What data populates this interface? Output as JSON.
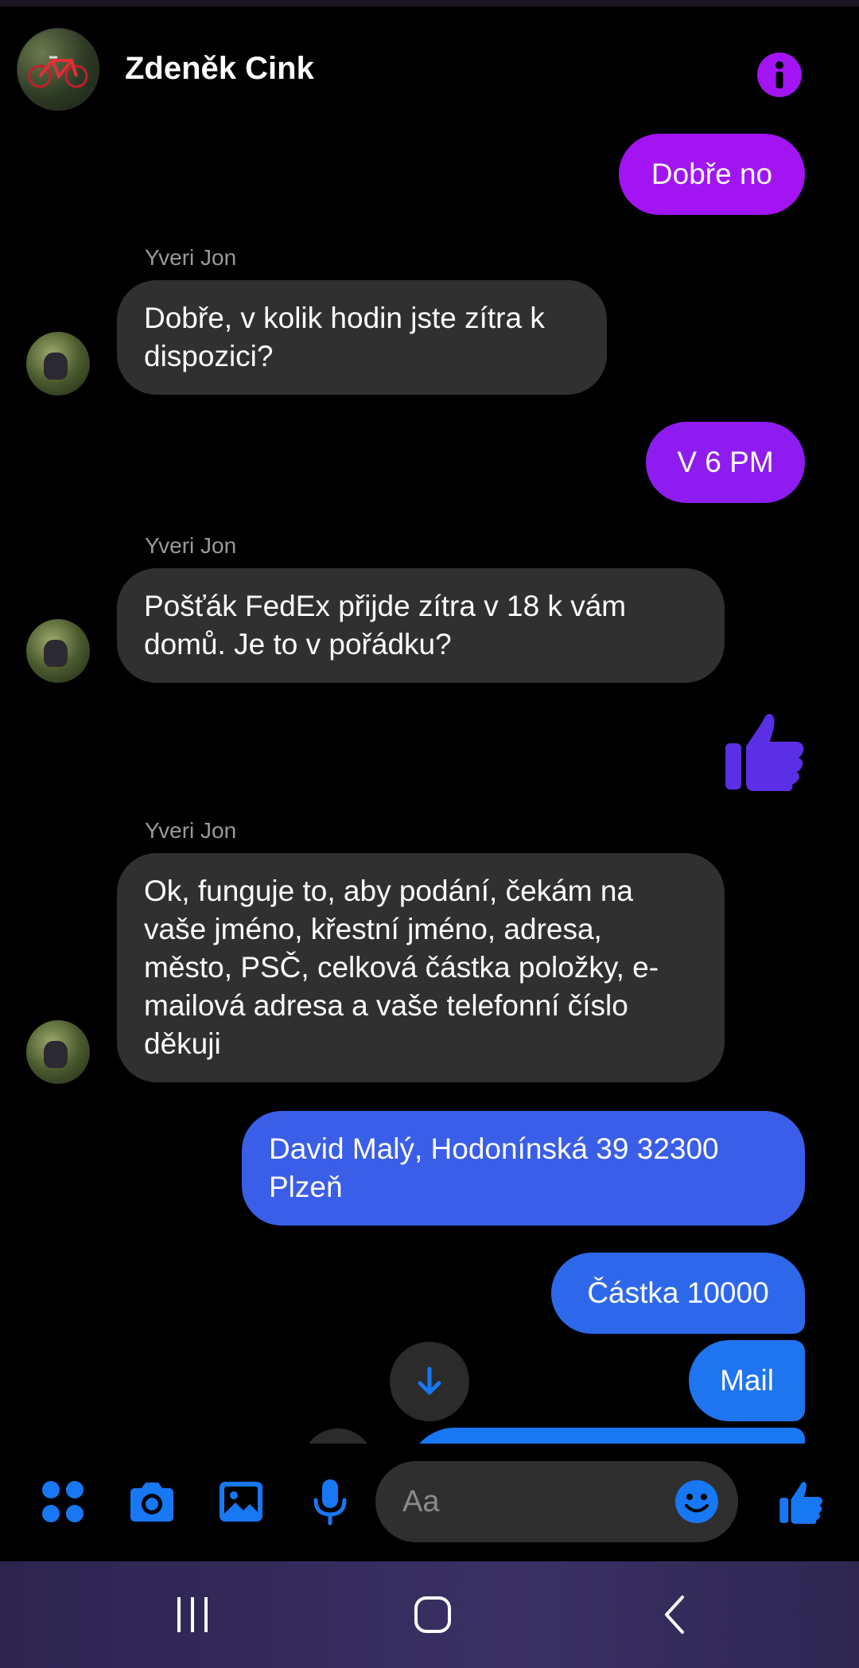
{
  "header": {
    "contact_name": "Zdeněk Cink"
  },
  "messages": [
    {
      "direction": "out",
      "text": "Dobře no"
    },
    {
      "direction": "in",
      "sender": "Yveri Jon",
      "text": "Dobře, v kolik hodin jste zítra k dispozici?"
    },
    {
      "direction": "out",
      "text": "V 6 PM"
    },
    {
      "direction": "in",
      "sender": "Yveri Jon",
      "text": "Pošťák FedEx přijde zítra v 18 k vám domů. Je to v pořádku?"
    },
    {
      "direction": "out",
      "type": "like"
    },
    {
      "direction": "in",
      "sender": "Yveri Jon",
      "text": "Ok, funguje to, aby podání, čekám na vaše jméno, křestní jméno, adresa, město, PSČ, celková částka položky, e-mailová adresa a vaše telefonní číslo děkuji"
    },
    {
      "direction": "out",
      "text": "David Malý, Hodonínská 39 32300 Plzeň"
    },
    {
      "direction": "out",
      "text": "Částka 10000"
    },
    {
      "direction": "out",
      "text": "Mail"
    }
  ],
  "composer": {
    "placeholder": "Aa",
    "icons": [
      "apps-icon",
      "camera-icon",
      "gallery-icon",
      "microphone-icon",
      "emoji-icon",
      "thumbs-up-icon"
    ]
  },
  "navbar": {
    "icons": [
      "recent-apps-icon",
      "home-icon",
      "back-icon"
    ]
  },
  "colors": {
    "accent_purple": "#a214f2",
    "accent_blue": "#1877f2",
    "incoming_bubble": "#303030"
  }
}
